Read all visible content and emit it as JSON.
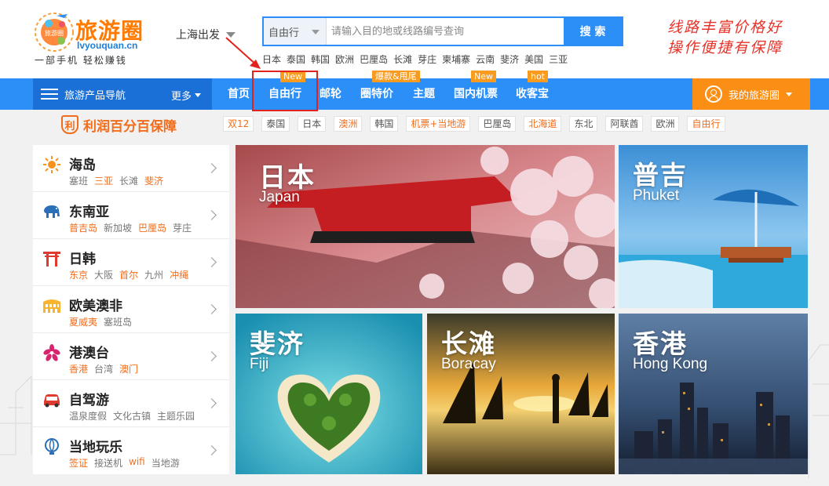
{
  "colors": {
    "brand_blue": "#2b8ff7",
    "brand_orange": "#fb8e14",
    "highlight_red": "#e0231d"
  },
  "logo": {
    "badge_text": "旅游圈",
    "name": "旅游圈",
    "url": "lvyouquan.cn",
    "slogan": "一部手机 轻松赚钱"
  },
  "city_selector": {
    "label": "上海出发"
  },
  "search": {
    "type_value": "自由行",
    "placeholder": "请输入目的地或线路编号查询",
    "button_label": "搜 索"
  },
  "hotwords": [
    "日本",
    "泰国",
    "韩国",
    "欧洲",
    "巴厘岛",
    "长滩",
    "芽庄",
    "柬埔寨",
    "云南",
    "斐济",
    "美国",
    "三亚"
  ],
  "tagline": {
    "line1": "线路丰富价格好",
    "line2": "操作便捷有保障"
  },
  "nav": {
    "product_label": "旅游产品导航",
    "more_label": "更多",
    "items": [
      {
        "label": "首页",
        "badge": ""
      },
      {
        "label": "自由行",
        "badge": "New"
      },
      {
        "label": "邮轮",
        "badge": ""
      },
      {
        "label": "圈特价",
        "badge": "爆款&甩尾"
      },
      {
        "label": "主题",
        "badge": ""
      },
      {
        "label": "国内机票",
        "badge": "New"
      },
      {
        "label": "收客宝",
        "badge": "hot"
      }
    ],
    "account_label": "我的旅游圈"
  },
  "guarantee": {
    "icon_text": "利",
    "label": "利润百分百保障"
  },
  "quick_tags": [
    {
      "label": "双12",
      "hot": true
    },
    {
      "label": "泰国",
      "hot": false
    },
    {
      "label": "日本",
      "hot": false
    },
    {
      "label": "澳洲",
      "hot": true
    },
    {
      "label": "韩国",
      "hot": false
    },
    {
      "label": "机票+当地游",
      "hot": true
    },
    {
      "label": "巴厘岛",
      "hot": false
    },
    {
      "label": "北海道",
      "hot": true
    },
    {
      "label": "东北",
      "hot": false
    },
    {
      "label": "阿联酋",
      "hot": false
    },
    {
      "label": "欧洲",
      "hot": false
    },
    {
      "label": "自由行",
      "hot": true
    }
  ],
  "categories": [
    {
      "title": "海岛",
      "icon": "sun-icon",
      "subs": [
        {
          "t": "塞班",
          "hot": false
        },
        {
          "t": "三亚",
          "hot": true
        },
        {
          "t": "长滩",
          "hot": false
        },
        {
          "t": "斐济",
          "hot": true
        }
      ]
    },
    {
      "title": "东南亚",
      "icon": "elephant-icon",
      "subs": [
        {
          "t": "普吉岛",
          "hot": true
        },
        {
          "t": "新加坡",
          "hot": false
        },
        {
          "t": "巴厘岛",
          "hot": true
        },
        {
          "t": "芽庄",
          "hot": false
        }
      ]
    },
    {
      "title": "日韩",
      "icon": "torii-icon",
      "subs": [
        {
          "t": "东京",
          "hot": true
        },
        {
          "t": "大阪",
          "hot": false
        },
        {
          "t": "首尔",
          "hot": true
        },
        {
          "t": "九州",
          "hot": false
        },
        {
          "t": "冲绳",
          "hot": true
        }
      ]
    },
    {
      "title": "欧美澳非",
      "icon": "colosseum-icon",
      "subs": [
        {
          "t": "夏威夷",
          "hot": true
        },
        {
          "t": "塞班岛",
          "hot": false
        }
      ]
    },
    {
      "title": "港澳台",
      "icon": "bauhinia-icon",
      "subs": [
        {
          "t": "香港",
          "hot": true
        },
        {
          "t": "台湾",
          "hot": false
        },
        {
          "t": "澳门",
          "hot": true
        }
      ]
    },
    {
      "title": "自驾游",
      "icon": "car-icon",
      "subs": [
        {
          "t": "温泉度假",
          "hot": false
        },
        {
          "t": "文化古镇",
          "hot": false
        },
        {
          "t": "主题乐园",
          "hot": false
        }
      ]
    },
    {
      "title": "当地玩乐",
      "icon": "balloon-icon",
      "subs": [
        {
          "t": "签证",
          "hot": true
        },
        {
          "t": "接送机",
          "hot": false
        },
        {
          "t": "wifi",
          "hot": true
        },
        {
          "t": "当地游",
          "hot": false
        }
      ]
    }
  ],
  "tiles": [
    {
      "cn": "日本",
      "en": "Japan"
    },
    {
      "cn": "普吉",
      "en": "Phuket"
    },
    {
      "cn": "斐济",
      "en": "Fiji"
    },
    {
      "cn": "长滩",
      "en": "Boracay"
    },
    {
      "cn": "香港",
      "en": "Hong Kong"
    }
  ]
}
